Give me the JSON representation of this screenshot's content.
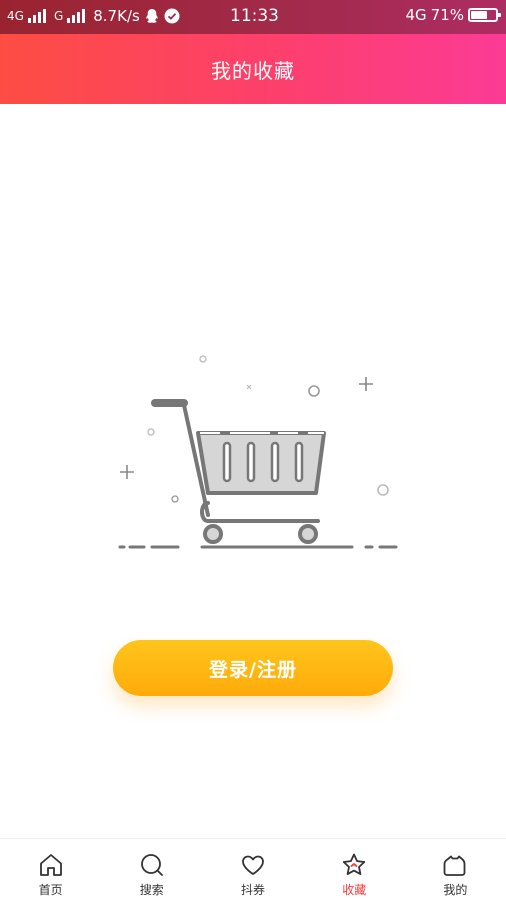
{
  "status_bar": {
    "net1": "4G",
    "net2": "G",
    "speed": "8.7K/s",
    "time": "11:33",
    "net_right": "4G",
    "battery_text": "71%",
    "battery_level": 0.71
  },
  "header": {
    "title": "我的收藏"
  },
  "empty_state": {
    "icon": "shopping-cart-icon"
  },
  "login_button": {
    "label": "登录/注册"
  },
  "tabbar": {
    "active_color": "#f23d3d",
    "items": [
      {
        "label": "首页",
        "icon": "home-icon"
      },
      {
        "label": "搜索",
        "icon": "search-icon"
      },
      {
        "label": "抖券",
        "icon": "heart-icon"
      },
      {
        "label": "收藏",
        "icon": "star-icon",
        "active": true
      },
      {
        "label": "我的",
        "icon": "profile-icon"
      }
    ]
  }
}
